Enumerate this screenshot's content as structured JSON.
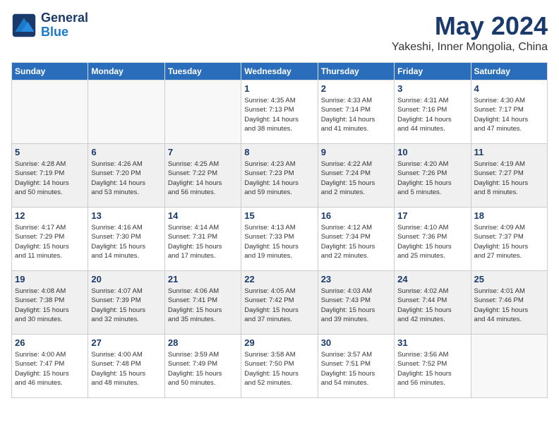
{
  "header": {
    "logo_line1": "General",
    "logo_line2": "Blue",
    "month": "May 2024",
    "location": "Yakeshi, Inner Mongolia, China"
  },
  "days_of_week": [
    "Sunday",
    "Monday",
    "Tuesday",
    "Wednesday",
    "Thursday",
    "Friday",
    "Saturday"
  ],
  "weeks": [
    {
      "shade": false,
      "cells": [
        {
          "day": "",
          "info": ""
        },
        {
          "day": "",
          "info": ""
        },
        {
          "day": "",
          "info": ""
        },
        {
          "day": "1",
          "info": "Sunrise: 4:35 AM\nSunset: 7:13 PM\nDaylight: 14 hours\nand 38 minutes."
        },
        {
          "day": "2",
          "info": "Sunrise: 4:33 AM\nSunset: 7:14 PM\nDaylight: 14 hours\nand 41 minutes."
        },
        {
          "day": "3",
          "info": "Sunrise: 4:31 AM\nSunset: 7:16 PM\nDaylight: 14 hours\nand 44 minutes."
        },
        {
          "day": "4",
          "info": "Sunrise: 4:30 AM\nSunset: 7:17 PM\nDaylight: 14 hours\nand 47 minutes."
        }
      ]
    },
    {
      "shade": true,
      "cells": [
        {
          "day": "5",
          "info": "Sunrise: 4:28 AM\nSunset: 7:19 PM\nDaylight: 14 hours\nand 50 minutes."
        },
        {
          "day": "6",
          "info": "Sunrise: 4:26 AM\nSunset: 7:20 PM\nDaylight: 14 hours\nand 53 minutes."
        },
        {
          "day": "7",
          "info": "Sunrise: 4:25 AM\nSunset: 7:22 PM\nDaylight: 14 hours\nand 56 minutes."
        },
        {
          "day": "8",
          "info": "Sunrise: 4:23 AM\nSunset: 7:23 PM\nDaylight: 14 hours\nand 59 minutes."
        },
        {
          "day": "9",
          "info": "Sunrise: 4:22 AM\nSunset: 7:24 PM\nDaylight: 15 hours\nand 2 minutes."
        },
        {
          "day": "10",
          "info": "Sunrise: 4:20 AM\nSunset: 7:26 PM\nDaylight: 15 hours\nand 5 minutes."
        },
        {
          "day": "11",
          "info": "Sunrise: 4:19 AM\nSunset: 7:27 PM\nDaylight: 15 hours\nand 8 minutes."
        }
      ]
    },
    {
      "shade": false,
      "cells": [
        {
          "day": "12",
          "info": "Sunrise: 4:17 AM\nSunset: 7:29 PM\nDaylight: 15 hours\nand 11 minutes."
        },
        {
          "day": "13",
          "info": "Sunrise: 4:16 AM\nSunset: 7:30 PM\nDaylight: 15 hours\nand 14 minutes."
        },
        {
          "day": "14",
          "info": "Sunrise: 4:14 AM\nSunset: 7:31 PM\nDaylight: 15 hours\nand 17 minutes."
        },
        {
          "day": "15",
          "info": "Sunrise: 4:13 AM\nSunset: 7:33 PM\nDaylight: 15 hours\nand 19 minutes."
        },
        {
          "day": "16",
          "info": "Sunrise: 4:12 AM\nSunset: 7:34 PM\nDaylight: 15 hours\nand 22 minutes."
        },
        {
          "day": "17",
          "info": "Sunrise: 4:10 AM\nSunset: 7:36 PM\nDaylight: 15 hours\nand 25 minutes."
        },
        {
          "day": "18",
          "info": "Sunrise: 4:09 AM\nSunset: 7:37 PM\nDaylight: 15 hours\nand 27 minutes."
        }
      ]
    },
    {
      "shade": true,
      "cells": [
        {
          "day": "19",
          "info": "Sunrise: 4:08 AM\nSunset: 7:38 PM\nDaylight: 15 hours\nand 30 minutes."
        },
        {
          "day": "20",
          "info": "Sunrise: 4:07 AM\nSunset: 7:39 PM\nDaylight: 15 hours\nand 32 minutes."
        },
        {
          "day": "21",
          "info": "Sunrise: 4:06 AM\nSunset: 7:41 PM\nDaylight: 15 hours\nand 35 minutes."
        },
        {
          "day": "22",
          "info": "Sunrise: 4:05 AM\nSunset: 7:42 PM\nDaylight: 15 hours\nand 37 minutes."
        },
        {
          "day": "23",
          "info": "Sunrise: 4:03 AM\nSunset: 7:43 PM\nDaylight: 15 hours\nand 39 minutes."
        },
        {
          "day": "24",
          "info": "Sunrise: 4:02 AM\nSunset: 7:44 PM\nDaylight: 15 hours\nand 42 minutes."
        },
        {
          "day": "25",
          "info": "Sunrise: 4:01 AM\nSunset: 7:46 PM\nDaylight: 15 hours\nand 44 minutes."
        }
      ]
    },
    {
      "shade": false,
      "cells": [
        {
          "day": "26",
          "info": "Sunrise: 4:00 AM\nSunset: 7:47 PM\nDaylight: 15 hours\nand 46 minutes."
        },
        {
          "day": "27",
          "info": "Sunrise: 4:00 AM\nSunset: 7:48 PM\nDaylight: 15 hours\nand 48 minutes."
        },
        {
          "day": "28",
          "info": "Sunrise: 3:59 AM\nSunset: 7:49 PM\nDaylight: 15 hours\nand 50 minutes."
        },
        {
          "day": "29",
          "info": "Sunrise: 3:58 AM\nSunset: 7:50 PM\nDaylight: 15 hours\nand 52 minutes."
        },
        {
          "day": "30",
          "info": "Sunrise: 3:57 AM\nSunset: 7:51 PM\nDaylight: 15 hours\nand 54 minutes."
        },
        {
          "day": "31",
          "info": "Sunrise: 3:56 AM\nSunset: 7:52 PM\nDaylight: 15 hours\nand 56 minutes."
        },
        {
          "day": "",
          "info": ""
        }
      ]
    }
  ]
}
